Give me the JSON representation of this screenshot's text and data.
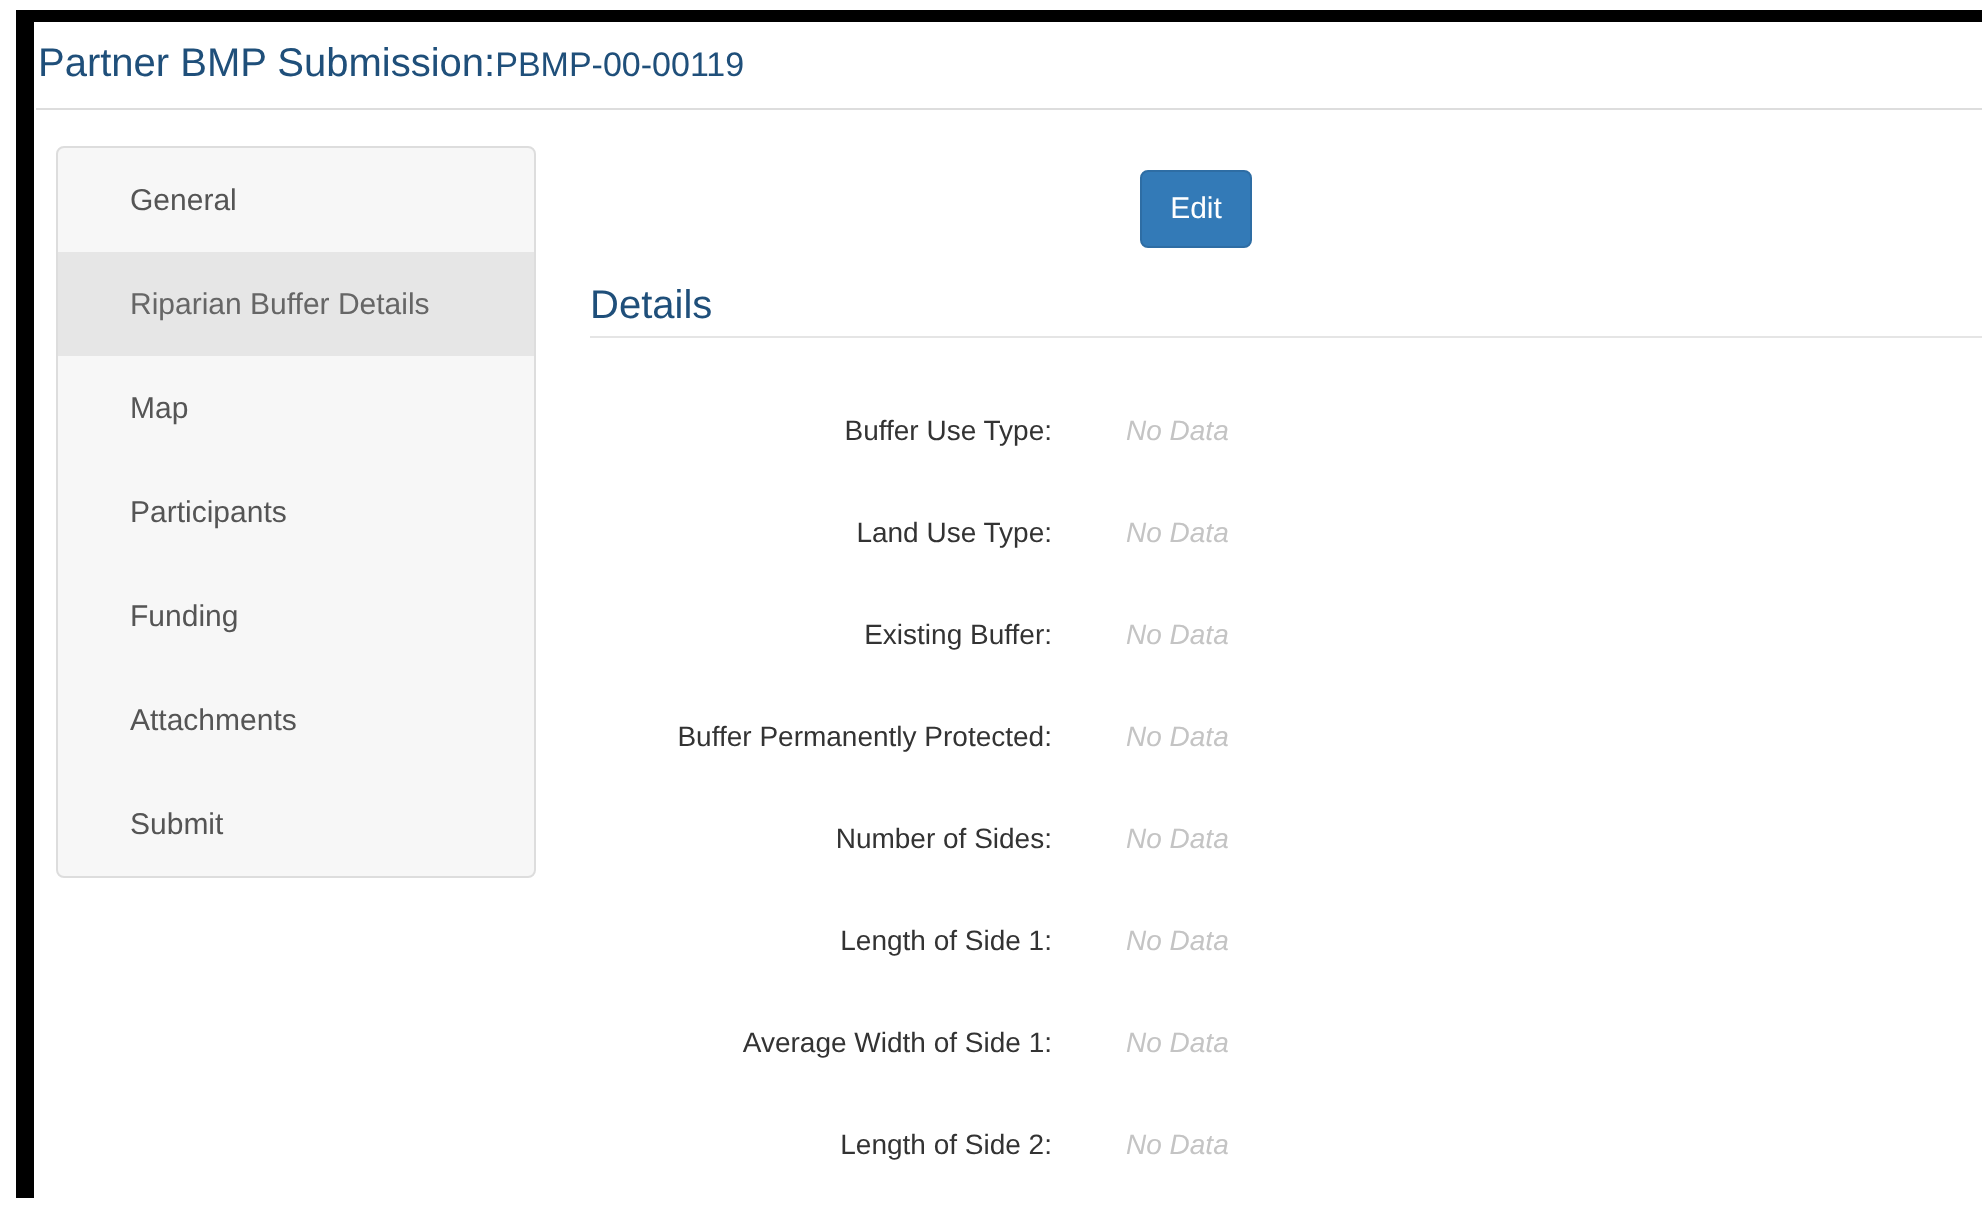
{
  "header": {
    "title": "Partner BMP Submission:",
    "record_id": "PBMP-00-00119"
  },
  "sidebar": {
    "items": [
      {
        "label": "General",
        "selected": false
      },
      {
        "label": "Riparian Buffer Details",
        "selected": true
      },
      {
        "label": "Map",
        "selected": false
      },
      {
        "label": "Participants",
        "selected": false
      },
      {
        "label": "Funding",
        "selected": false
      },
      {
        "label": "Attachments",
        "selected": false
      },
      {
        "label": "Submit",
        "selected": false
      }
    ]
  },
  "edit_button": "Edit",
  "section_title": "Details",
  "fields": [
    {
      "label": "Buffer Use Type:",
      "value": "No Data"
    },
    {
      "label": "Land Use Type:",
      "value": "No Data"
    },
    {
      "label": "Existing Buffer:",
      "value": "No Data"
    },
    {
      "label": "Buffer Permanently Protected:",
      "value": "No Data"
    },
    {
      "label": "Number of Sides:",
      "value": "No Data"
    },
    {
      "label": "Length of Side 1:",
      "value": "No Data"
    },
    {
      "label": "Average Width of Side 1:",
      "value": "No Data"
    },
    {
      "label": "Length of Side 2:",
      "value": "No Data"
    }
  ]
}
